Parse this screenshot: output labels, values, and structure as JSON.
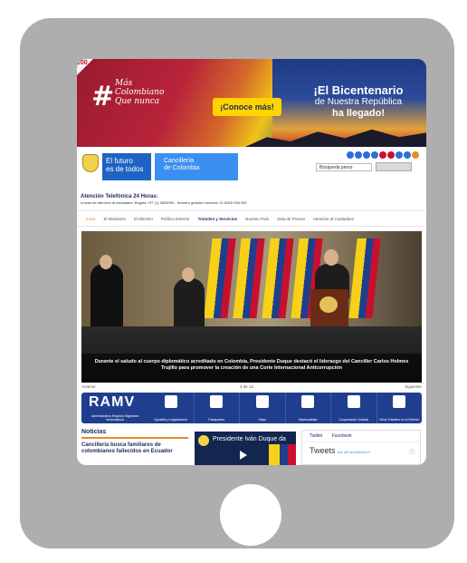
{
  "banner": {
    "badge": "200",
    "hashtag": "#",
    "slogan_1": "Más",
    "slogan_2": "Colombiano",
    "slogan_3": "Que nunca",
    "cta": "¡Conoce más!",
    "bicentenario_1": "¡El Bicentenario",
    "bicentenario_2": "de Nuestra República",
    "bicentenario_3": "ha llegado!"
  },
  "header": {
    "futuro_1": "El futuro",
    "futuro_2": "es de todos",
    "cancilleria_1": "Cancillería",
    "cancilleria_2": "de Colombia",
    "search_placeholder": "Búsqueda perso",
    "social_colors": [
      "#2d6fd6",
      "#2d6fd6",
      "#2d6fd6",
      "#2d6fd6",
      "#c8102e",
      "#c8102e",
      "#2d6fd6",
      "#2d6fd6",
      "#e38b2c"
    ]
  },
  "atencion": {
    "title": "Atención Telefónica 24 Horas:",
    "sub": "Líneas de atención al ciudadano: Bogotá +57 (1) 3826999 - Número gratuito nacional: 01 8000 938 000"
  },
  "nav": [
    "Inicio",
    "El Ministerio",
    "El Ministro",
    "Política Exterior",
    "Trámites y Servicios",
    "Nuestro País",
    "Sala de Prensa",
    "Atención al Ciudadano"
  ],
  "hero": {
    "caption": "Durante el saludo al cuerpo diplomático acreditado en Colombia, Presidente Duque destacó el liderazgo del Canciller Carlos Holmes Trujillo para promover la creación de una Corte Internacional Anticorrupción",
    "prev": "Anterior",
    "counter": "3 de 12",
    "next": "Siguiente"
  },
  "iconbar": {
    "ramv": "RAMV",
    "ramv_sub": "Administrativo Registro Migrantes Venezolanos",
    "items": [
      "Apostilla y Legalización",
      "Pasaportes",
      "Visas",
      "Nacionalidad",
      "Cooperación Judicial",
      "Otros Trámites en el Exterior"
    ]
  },
  "news": {
    "title": "Noticias",
    "item": "Cancillería busca familiares de colombianos fallecidos en Ecuador"
  },
  "video": {
    "title": "Presidente Iván Duque da"
  },
  "twitter": {
    "tab1": "Twitter",
    "tab2": "Facebook",
    "heading": "Tweets",
    "by": "por @CancilleriaCol"
  }
}
